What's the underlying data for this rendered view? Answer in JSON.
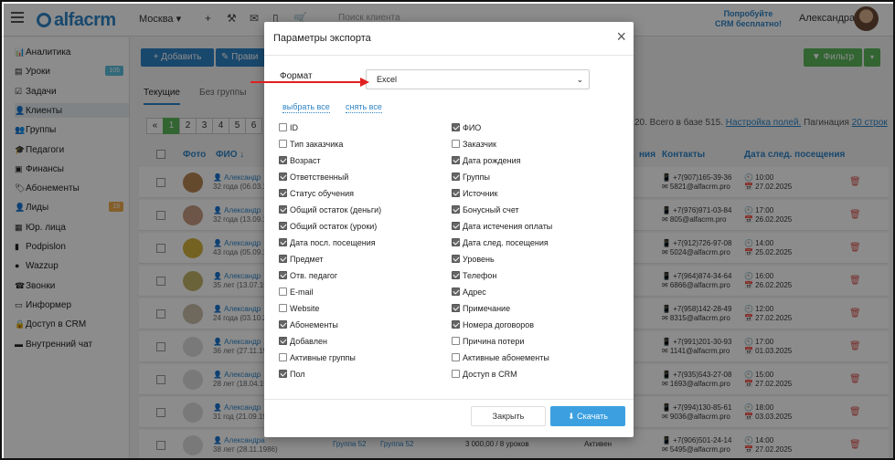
{
  "topbar": {
    "logo": "alfacrm",
    "branch": "Москва ▾",
    "search_placeholder": "Поиск клиента",
    "try_line1": "Попробуйте",
    "try_line2": "CRM бесплатно!",
    "user_name": "Александра",
    "icons": [
      "plus-icon",
      "wrench-icon",
      "mail-icon",
      "phone-icon",
      "cart-icon"
    ]
  },
  "sidebar": {
    "items": [
      {
        "label": "Аналитика",
        "icon": "📊"
      },
      {
        "label": "Уроки",
        "icon": "▤",
        "badge": "105",
        "badge_color": "#5bc0de"
      },
      {
        "label": "Задачи",
        "icon": "☑"
      },
      {
        "label": "Клиенты",
        "icon": "👤"
      },
      {
        "label": "Группы",
        "icon": "👥"
      },
      {
        "label": "Педагоги",
        "icon": "🎓"
      },
      {
        "label": "Финансы",
        "icon": "▣"
      },
      {
        "label": "Абонементы",
        "icon": "🏷"
      },
      {
        "label": "Лиды",
        "icon": "👤",
        "badge": "19",
        "badge_color": "#f0ad4e"
      },
      {
        "label": "Юр. лица",
        "icon": "▦"
      },
      {
        "label": "Podpislon",
        "icon": "▮"
      },
      {
        "label": "Wazzup",
        "icon": "●"
      },
      {
        "label": "Звонки",
        "icon": "☎"
      },
      {
        "label": "Информер",
        "icon": "▭"
      },
      {
        "label": "Доступ в CRM",
        "icon": "🔒"
      },
      {
        "label": "Внутренний чат",
        "icon": "▬"
      }
    ],
    "active_index": 3
  },
  "main": {
    "add_label": "+ Добавить",
    "add2_label": "✎ Прави",
    "filter_label": "▼ Фильтр",
    "filter_caret": "▾",
    "tabs": [
      "Текущие",
      "Без группы"
    ],
    "pages": [
      "«",
      "1",
      "2",
      "3",
      "4",
      "5",
      "6"
    ],
    "stat_text": "20. Всего в базе 515.",
    "stat_link": "Настройка полей.",
    "stat_pag": "Пагинация",
    "stat_pag_link": "20 строк",
    "columns": {
      "photo": "Фото",
      "fio": "ФИО ↓",
      "status": "ния",
      "contacts": "Контакты",
      "next_visit": "Дата след. посещения"
    },
    "rows": [
      {
        "name": "👤 Александр",
        "age": "32 года (06.03.1",
        "phone": "📱 +7(907)165-39-36",
        "email": "✉ 5821@alfacrm.pro",
        "time": "🕙 10:00",
        "date": "📅 27.02.2025",
        "photo": "#b98552"
      },
      {
        "name": "👤 Александр",
        "age": "32 года (13.09.1",
        "phone": "📱 +7(976)971-03-84",
        "email": "✉ 805@alfacrm.pro",
        "time": "🕙 17:00",
        "date": "📅 26.02.2025",
        "photo": "#c79b82"
      },
      {
        "name": "👤 Александр",
        "age": "43 года (05.09.1",
        "phone": "📱 +7(912)726-97-08",
        "email": "✉ 5024@alfacrm.pro",
        "time": "🕙 14:00",
        "date": "📅 25.02.2025",
        "photo": "#d2b23c"
      },
      {
        "name": "👤 Александр",
        "age": "35 лет (13.07.19",
        "phone": "📱 +7(964)874-34-64",
        "email": "✉ 6866@alfacrm.pro",
        "time": "🕙 16:00",
        "date": "📅 26.02.2025",
        "photo": "#c2b56b"
      },
      {
        "name": "👤 Александр",
        "age": "24 года (03.10.2",
        "phone": "📱 +7(958)142-28-49",
        "email": "✉ 8315@alfacrm.pro",
        "time": "🕙 12:00",
        "date": "📅 27.02.2025",
        "photo": "#c9bfa8"
      },
      {
        "name": "👤 Александр",
        "age": "36 лет (27.11.19",
        "phone": "📱 +7(991)201-30-93",
        "email": "✉ 1141@alfacrm.pro",
        "time": "🕙 17:00",
        "date": "📅 01.03.2025",
        "photo": "#dddddd"
      },
      {
        "name": "👤 Александр",
        "age": "28 лет (18.04.19",
        "phone": "📱 +7(935)543-27-08",
        "email": "✉ 1693@alfacrm.pro",
        "time": "🕙 15:00",
        "date": "📅 27.02.2025",
        "photo": "#dddddd"
      },
      {
        "name": "👤 Александр",
        "age": "31 год (21.09.19",
        "phone": "📱 +7(994)130-85-61",
        "email": "✉ 9036@alfacrm.pro",
        "time": "🕙 18:00",
        "date": "📅 03.03.2025",
        "photo": "#dddddd"
      },
      {
        "name": "👤 Александра",
        "age": "38 лет (28.11.1986)",
        "phone": "📱 +7(906)501-24-14",
        "email": "✉ 5495@alfacrm.pro",
        "time": "🕙 14:00",
        "date": "📅 27.02.2025",
        "photo": "#dddddd",
        "group": "Группа 52",
        "group2": "Группа 52",
        "balance": "3 000,00 / 8 уроков",
        "status": "Активен"
      }
    ]
  },
  "modal": {
    "title": "Параметры экспорта",
    "close": "×",
    "format_label": "Формат",
    "format_value": "Excel",
    "select_all": "выбрать все",
    "deselect_all": "снять все",
    "left_fields": [
      {
        "label": "ID",
        "checked": false
      },
      {
        "label": "Тип заказчика",
        "checked": false
      },
      {
        "label": "Возраст",
        "checked": true
      },
      {
        "label": "Ответственный",
        "checked": true
      },
      {
        "label": "Статус обучения",
        "checked": true
      },
      {
        "label": "Общий остаток (деньги)",
        "checked": true
      },
      {
        "label": "Общий остаток (уроки)",
        "checked": true
      },
      {
        "label": "Дата посл. посещения",
        "checked": true
      },
      {
        "label": "Предмет",
        "checked": true
      },
      {
        "label": "Отв. педагог",
        "checked": true
      },
      {
        "label": "E-mail",
        "checked": false
      },
      {
        "label": "Website",
        "checked": false
      },
      {
        "label": "Абонементы",
        "checked": true
      },
      {
        "label": "Добавлен",
        "checked": true
      },
      {
        "label": "Активные группы",
        "checked": false
      },
      {
        "label": "Пол",
        "checked": true
      }
    ],
    "right_fields": [
      {
        "label": "ФИО",
        "checked": true
      },
      {
        "label": "Заказчик",
        "checked": false
      },
      {
        "label": "Дата рождения",
        "checked": true
      },
      {
        "label": "Группы",
        "checked": true
      },
      {
        "label": "Источник",
        "checked": true
      },
      {
        "label": "Бонусный счет",
        "checked": true
      },
      {
        "label": "Дата истечения оплаты",
        "checked": true
      },
      {
        "label": "Дата след. посещения",
        "checked": true
      },
      {
        "label": "Уровень",
        "checked": true
      },
      {
        "label": "Телефон",
        "checked": true
      },
      {
        "label": "Адрес",
        "checked": true
      },
      {
        "label": "Примечание",
        "checked": true
      },
      {
        "label": "Номера договоров",
        "checked": true
      },
      {
        "label": "Причина потери",
        "checked": false
      },
      {
        "label": "Активные абонементы",
        "checked": false
      },
      {
        "label": "Доступ в CRM",
        "checked": false
      }
    ],
    "close_button": "Закрыть",
    "download_button": "⬇ Скачать"
  },
  "colors": {
    "accent": "#2f84c6",
    "success": "#5cb85c",
    "annotation_arrow": "#e02020"
  }
}
